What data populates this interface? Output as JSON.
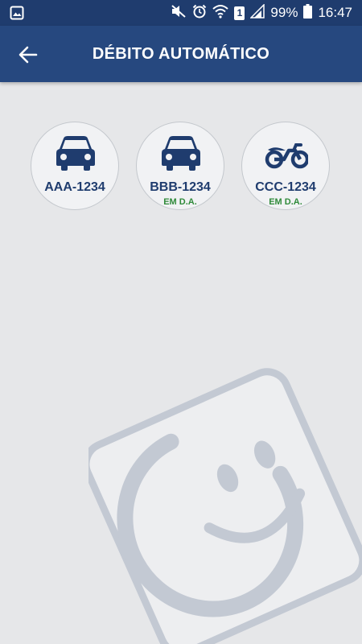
{
  "status_bar": {
    "notification_icon": "image-icon",
    "icons": [
      "mute-icon",
      "alarm-icon",
      "wifi-icon",
      "sim-icon",
      "signal-icon",
      "battery-icon"
    ],
    "sim_label": "1",
    "battery": "99%",
    "time": "16:47"
  },
  "app_bar": {
    "back_icon": "arrow-left-icon",
    "title": "DÉBITO AUTOMÁTICO"
  },
  "vehicles": [
    {
      "icon": "car-icon",
      "plate": "AAA-1234",
      "status": ""
    },
    {
      "icon": "car-icon",
      "plate": "BBB-1234",
      "status": "EM D.A."
    },
    {
      "icon": "motorcycle-icon",
      "plate": "CCC-1234",
      "status": "EM D.A."
    }
  ],
  "colors": {
    "status_bar": "#1f3c6e",
    "app_bar": "#26487f",
    "background": "#e6e7e9",
    "plate_text": "#1f3c6e",
    "status_text": "#2f8a3a",
    "watermark": "#c3c9d3"
  },
  "watermark": {
    "icon": "smiley-logo-icon"
  }
}
